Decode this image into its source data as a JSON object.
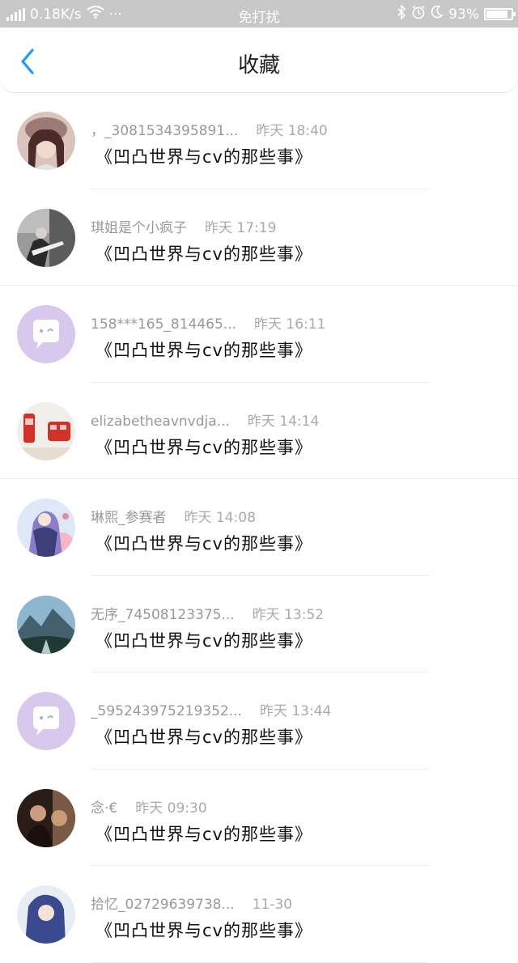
{
  "status_bar": {
    "network": "4G",
    "speed": "0.18K/s",
    "more": "···",
    "mode": "免打扰",
    "battery": "93%",
    "battery_level": 0.93
  },
  "header": {
    "title": "收藏",
    "back_icon": "chevron-left-icon"
  },
  "colors": {
    "accent": "#1a9bff",
    "status_bar": "#c8c8c8",
    "placeholder_avatar": "#d8c8ee"
  },
  "favorites": [
    {
      "user": "，_3081534395891...",
      "time": "昨天 18:40",
      "book": "《凹凸世界与cv的那些事》"
    },
    {
      "user": "琪姐是个小疯子",
      "time": "昨天 17:19",
      "book": "《凹凸世界与cv的那些事》"
    },
    {
      "user": "158***165_814465...",
      "time": "昨天 16:11",
      "book": "《凹凸世界与cv的那些事》"
    },
    {
      "user": "elizabetheavnvdja...",
      "time": "昨天 14:14",
      "book": "《凹凸世界与cv的那些事》"
    },
    {
      "user": "琳熙_参赛者",
      "time": "昨天 14:08",
      "book": "《凹凸世界与cv的那些事》"
    },
    {
      "user": "无序_74508123375...",
      "time": "昨天 13:52",
      "book": "《凹凸世界与cv的那些事》"
    },
    {
      "user": "_595243975219352...",
      "time": "昨天 13:44",
      "book": "《凹凸世界与cv的那些事》"
    },
    {
      "user": "念·€",
      "time": "昨天 09:30",
      "book": "《凹凸世界与cv的那些事》"
    },
    {
      "user": "拾忆_02729639738...",
      "time": "11-30",
      "book": "《凹凸世界与cv的那些事》"
    }
  ]
}
